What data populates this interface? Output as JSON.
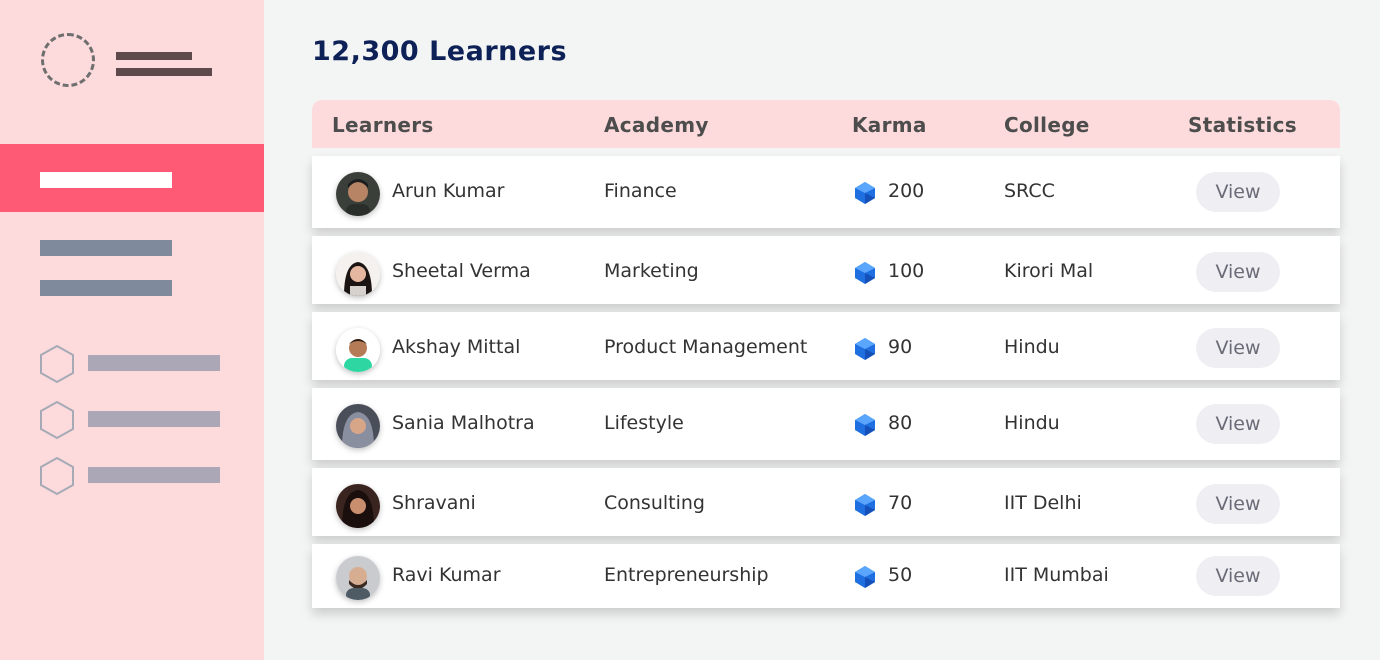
{
  "page": {
    "title": "12,300 Learners"
  },
  "colors": {
    "sidebar_bg": "#fddbdc",
    "sidebar_active": "#fe5a75",
    "title": "#0d2157",
    "karma_gem": "#1f6fe0"
  },
  "table": {
    "headers": [
      "Learners",
      "Academy",
      "Karma",
      "College",
      "Statistics"
    ],
    "rows": [
      {
        "name": "Arun Kumar",
        "academy": "Finance",
        "karma": "200",
        "college": "SRCC",
        "action": "View"
      },
      {
        "name": "Sheetal Verma",
        "academy": "Marketing",
        "karma": "100",
        "college": "Kirori Mal",
        "action": "View"
      },
      {
        "name": "Akshay Mittal",
        "academy": "Product Management",
        "karma": "90",
        "college": "Hindu",
        "action": "View"
      },
      {
        "name": "Sania Malhotra",
        "academy": "Lifestyle",
        "karma": "80",
        "college": "Hindu",
        "action": "View"
      },
      {
        "name": "Shravani",
        "academy": "Consulting",
        "karma": "70",
        "college": "IIT Delhi",
        "action": "View"
      },
      {
        "name": "Ravi Kumar",
        "academy": "Entrepreneurship",
        "karma": "50",
        "college": "IIT Mumbai",
        "action": "View"
      }
    ]
  },
  "icons": {
    "logo": "dashed-circle-logo-icon",
    "nav": "hexagon-icon",
    "karma": "gem-icon"
  }
}
